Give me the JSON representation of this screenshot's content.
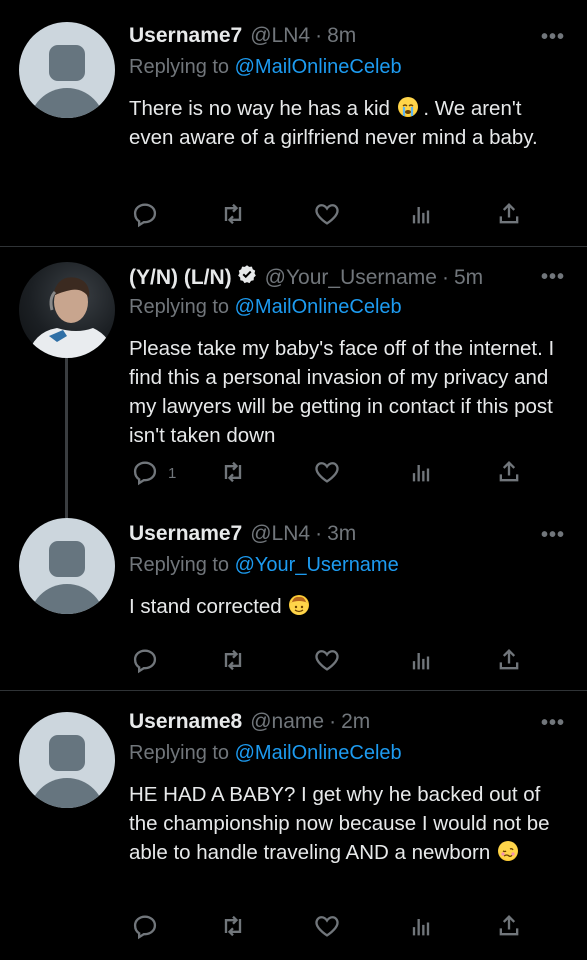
{
  "tweets": [
    {
      "name": "Username7",
      "handle": "@LN4",
      "dot": "·",
      "time": "8m",
      "replying_prefix": "Replying to",
      "replying_to": "@MailOnlineCeleb",
      "text": "There is no way he has a kid",
      "text_after_emoji": ". We aren't even aware of a girlfriend never mind a baby.",
      "emoji": "loudly-crying-face",
      "reply_count": "",
      "verified": false
    },
    {
      "name": "(Y/N) (L/N)",
      "handle": "@Your_Username",
      "dot": "·",
      "time": "5m",
      "replying_prefix": "Replying to",
      "replying_to": "@MailOnlineCeleb",
      "text": "Please take my baby's face off of the internet. I find this a personal invasion of my privacy and my lawyers will be getting in contact if this post isn't taken down",
      "reply_count": "1",
      "verified": true
    },
    {
      "name": "Username7",
      "handle": "@LN4",
      "dot": "·",
      "time": "3m",
      "replying_prefix": "Replying to",
      "replying_to": "@Your_Username",
      "text": "I stand corrected",
      "emoji": "cowboy-face",
      "reply_count": "",
      "verified": false
    },
    {
      "name": "Username8",
      "handle": "@name",
      "dot": "·",
      "time": "2m",
      "replying_prefix": "Replying to",
      "replying_to": "@MailOnlineCeleb",
      "text": "HE HAD A BABY? I get why he backed out of the championship now because I would not be able to handle traveling AND a newborn",
      "emoji": "woozy-face",
      "reply_count": "",
      "verified": false
    }
  ],
  "more_label": "•••",
  "colors": {
    "background": "#000000",
    "text": "#e7e9ea",
    "muted": "#71767b",
    "link": "#1d9bf0",
    "divider": "#2f3336"
  },
  "icons": [
    "reply-icon",
    "retweet-icon",
    "like-icon",
    "analytics-icon",
    "share-icon",
    "more-icon",
    "verified-badge-icon"
  ]
}
